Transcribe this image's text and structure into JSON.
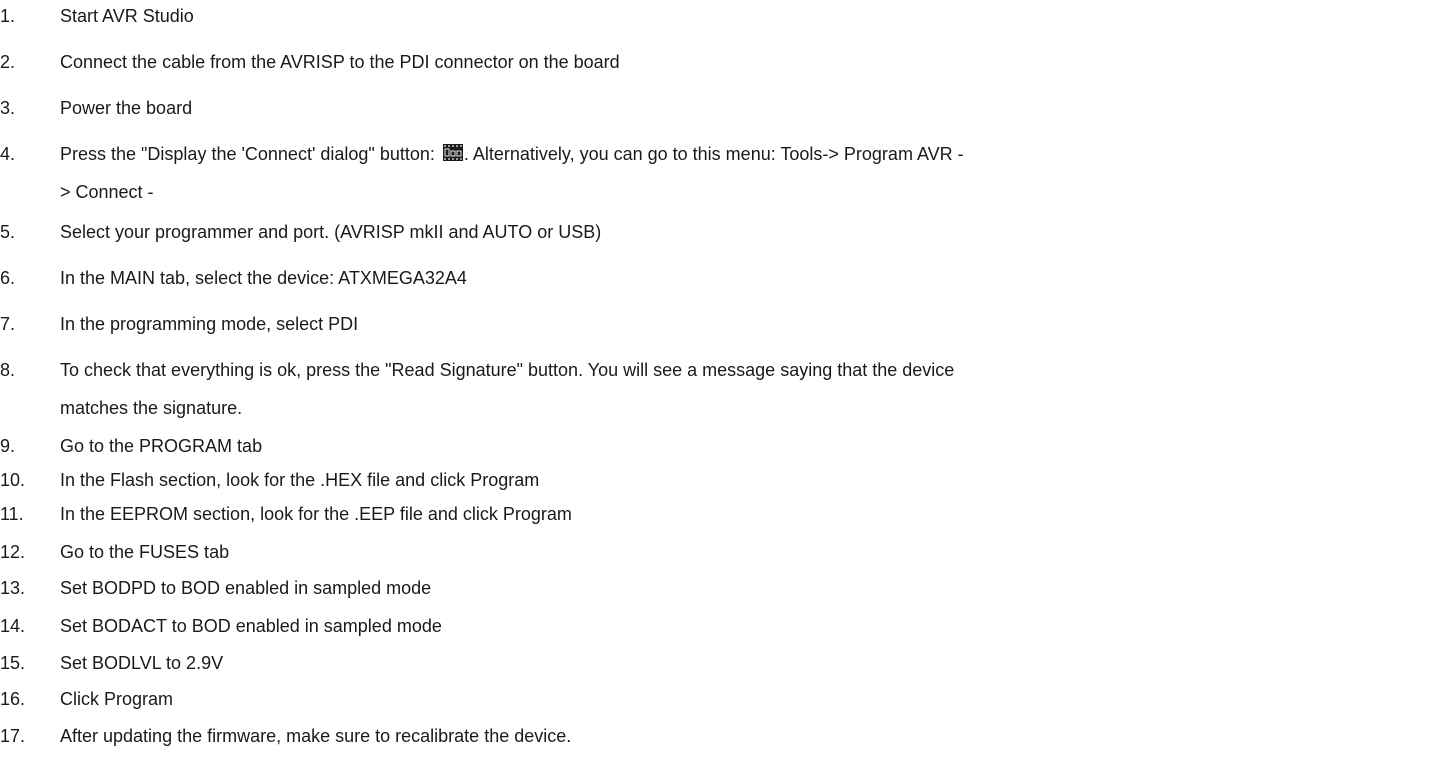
{
  "steps": [
    {
      "num": "1.",
      "text": "Start AVR Studio"
    },
    {
      "num": "2.",
      "text": "Connect the cable from the AVRISP to the PDI connector on the board"
    },
    {
      "num": "3.",
      "text": "Power the board"
    },
    {
      "num": "4.",
      "text_before_icon": "Press the \"Display the 'Connect' dialog\" button: ",
      "icon": "connect-dialog-icon",
      "text_after_icon": ". Alternatively, you can go to this menu: Tools-> Program AVR -",
      "text_line2": "> Connect -"
    },
    {
      "num": "5.",
      "text": "Select your programmer and port. (AVRISP mkII and AUTO or USB)"
    },
    {
      "num": "6.",
      "text": "In the MAIN tab, select the device: ATXMEGA32A4"
    },
    {
      "num": "7.",
      "text": "In the programming mode, select PDI"
    },
    {
      "num": "8.",
      "text": "To check that everything is ok, press the \"Read Signature\" button. You will see a message saying that the device",
      "text_line2": "matches the signature."
    },
    {
      "num": "9.",
      "text": "Go to the PROGRAM tab"
    },
    {
      "num": "10.",
      "text": "In the Flash section, look for the .HEX file and click Program"
    },
    {
      "num": "11.",
      "text": "In the EEPROM section, look for the .EEP file and click Program"
    },
    {
      "num": "12.",
      "text": "Go to the FUSES tab"
    },
    {
      "num": "13.",
      "text": "Set BODPD to BOD enabled in sampled mode"
    },
    {
      "num": "14.",
      "text": "Set BODACT to BOD enabled in sampled mode"
    },
    {
      "num": "15.",
      "text": "Set BODLVL to 2.9V"
    },
    {
      "num": "16.",
      "text": "Click Program"
    },
    {
      "num": "17.",
      "text": "After updating the firmware, make sure to recalibrate the device."
    }
  ]
}
